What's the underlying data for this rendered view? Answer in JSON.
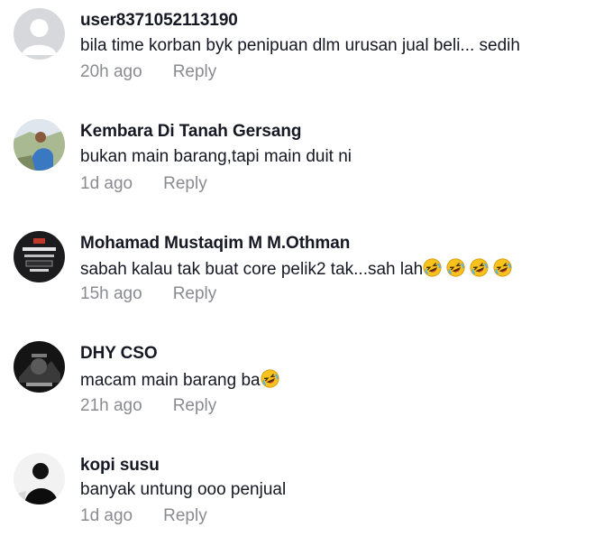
{
  "comments": [
    {
      "username": "user8371052113190",
      "text": "bila time korban byk penipuan dlm urusan jual beli... sedih",
      "time": "20h ago",
      "reply_label": "Reply",
      "avatar_icon": "default-user-avatar",
      "emojis": []
    },
    {
      "username": "Kembara Di Tanah Gersang",
      "text": "bukan main barang,tapi main duit ni",
      "time": "1d ago",
      "reply_label": "Reply",
      "avatar_icon": "photo-avatar",
      "emojis": []
    },
    {
      "username": "Mohamad Mustaqim M M.Othman",
      "text": "sabah kalau tak buat core pelik2 tak...sah lah",
      "time": "15h ago",
      "reply_label": "Reply",
      "avatar_icon": "photo-avatar",
      "emojis": [
        "rolling-on-floor-laughing",
        "rolling-on-floor-laughing",
        "rolling-on-floor-laughing",
        "rolling-on-floor-laughing"
      ]
    },
    {
      "username": "DHY CSO",
      "text": "macam main barang ba",
      "time": "21h ago",
      "reply_label": "Reply",
      "avatar_icon": "photo-avatar",
      "emojis": [
        "rolling-on-floor-laughing"
      ]
    },
    {
      "username": "kopi susu",
      "text": "banyak untung ooo penjual",
      "time": "1d ago",
      "reply_label": "Reply",
      "avatar_icon": "photo-avatar",
      "emojis": []
    }
  ],
  "colors": {
    "username": "#161823",
    "meta": "#8a8b91",
    "background": "#ffffff"
  }
}
